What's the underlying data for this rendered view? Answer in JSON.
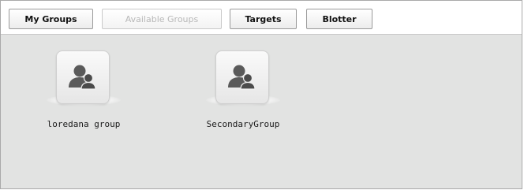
{
  "tabs": {
    "my_groups": "My Groups",
    "available_groups": "Available Groups",
    "targets": "Targets",
    "blotter": "Blotter"
  },
  "groups": [
    {
      "name": "loredana group",
      "icon": "group-icon"
    },
    {
      "name": "SecondaryGroup",
      "icon": "group-icon"
    }
  ],
  "colors": {
    "content_bg": "#e2e3e2",
    "icon_fill": "#5a5a5a",
    "disabled_text": "#b8b8b8"
  }
}
